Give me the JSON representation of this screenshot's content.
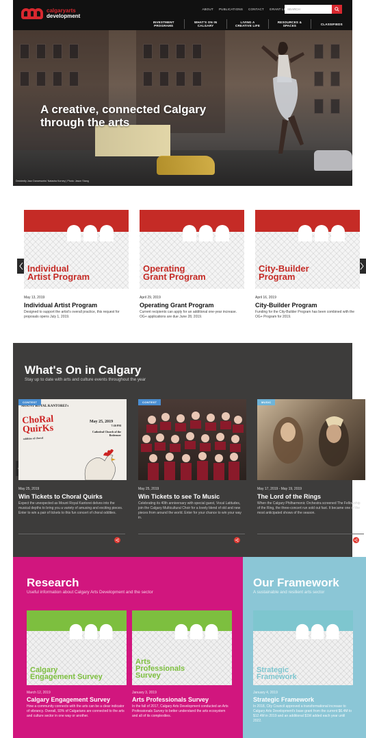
{
  "header": {
    "logo_line1": "calgaryarts",
    "logo_line2": "development",
    "utility_nav": [
      "ABOUT",
      "PUBLICATIONS",
      "CONTACT",
      "GRANT LOGIN"
    ],
    "search_placeholder": "SEARCH",
    "main_nav": [
      {
        "l1": "INVESTMENT",
        "l2": "PROGRAMS"
      },
      {
        "l1": "WHAT'S ON IN",
        "l2": "CALGARY"
      },
      {
        "l1": "LIVING A",
        "l2": "CREATIVE LIFE"
      },
      {
        "l1": "RESOURCES &",
        "l2": "SPACES"
      },
      {
        "l1": "CLASSIFIEDS",
        "l2": ""
      }
    ]
  },
  "hero": {
    "title_line1": "A creative, connected Calgary",
    "title_line2": "through the arts",
    "credit": "Decidedly Jazz Danceworks' Natasha Korney | Photo: Jason Stang"
  },
  "programs": [
    {
      "img_l1": "Individual",
      "img_l2": "Artist Program",
      "date": "May 13, 2019",
      "title": "Individual Artist Program",
      "desc": "Designed to support the artist's overall practice, this request for proposals opens July 1, 2019."
    },
    {
      "img_l1": "Operating",
      "img_l2": "Grant Program",
      "date": "April 29, 2019",
      "title": "Operating Grant Program",
      "desc": "Current recipients can apply for an additional one-year increase. OG+ applications are due June 28, 2019."
    },
    {
      "img_l1": "City-Builder",
      "img_l2": "Program",
      "date": "April 16, 2019",
      "title": "City-Builder Program",
      "desc": "Funding for the City-Builder Program has been combined with the OG+ Program for 2019."
    }
  ],
  "events_section": {
    "title": "What's On in Calgary",
    "subtitle": "Stay up to date with arts and culture events throughout the year"
  },
  "events": [
    {
      "tag": "CONTEST",
      "date": "May 25, 2019",
      "title": "Win Tickets to Choral Quirks",
      "desc": "Expect the unexpected as Mount Royal Kantorei delves into the musical depths to bring you a variety of amusing and exciting pieces. Enter to win a pair of tickets to this fun concert of choral oddities.",
      "poster_org": "MOUNT ROYAL KANTOREI's",
      "poster_title_1": "ChoRal",
      "poster_title_2": "QuirKs",
      "poster_sub": "oddities of choral",
      "poster_date": "May 25, 2019",
      "poster_time": "7:30 PM",
      "poster_venue": "Cathedral Church of the Redeemer"
    },
    {
      "tag": "CONTEST",
      "date": "May 25, 2019",
      "title": "Win Tickets to see To Music",
      "desc": "Celebrating its 40th anniversary with special guest, Vocal Latitudes, join the Calgary Multicultural Choir for a lovely blend of old and new pieces from around the world. Enter for your chance to win your way in."
    },
    {
      "tag": "MUSIC",
      "date": "May 17, 2019 - May 19, 2019",
      "title": "The Lord of the Rings",
      "desc": "When the Calgary Philharmonic Orchestra screened The Fellowship of the Ring, the three-concert run sold out fast. It became one of the most anticipated shows of the season."
    }
  ],
  "research": {
    "title": "Research",
    "subtitle": "Useful information about Calgary Arts Development and the sector",
    "cards": [
      {
        "img_l1": "Calgary",
        "img_l2": "Engagement Survey",
        "img_l3": "",
        "date": "March 12, 2019",
        "title": "Calgary Engagement Survey",
        "desc": "How a community connects with the arts can be a clear indicator of vibrancy. Overall, 93% of Calgarians are connected to the arts and culture sector in one way or another."
      },
      {
        "img_l1": "Arts",
        "img_l2": "Professionals",
        "img_l3": "Survey",
        "date": "January 3, 2019",
        "title": "Arts Professionals Survey",
        "desc": "In the fall of 2017, Calgary Arts Development conducted an Arts Professionals Survey to better understand the arts ecosystem and all of its complexities."
      }
    ]
  },
  "framework": {
    "title": "Our Framework",
    "subtitle": "A sustainable and resilient arts sector",
    "card": {
      "img_l1": "Strategic",
      "img_l2": "Framework",
      "date": "January 4, 2019",
      "title": "Strategic Framework",
      "desc": "In 2018, City Council approved a transformational increase to Calgary Arts Development's base grant from the current $6.4M to $12.4M in 2019 and an additional $1M added each year until 2022."
    }
  },
  "colors": {
    "brand_red": "#d7282f",
    "research_magenta": "#d1167e",
    "framework_blue": "#8bc6d6",
    "events_bg": "#3d3c3b",
    "research_green": "#7dbf3f",
    "framework_teal": "#7ec6cf"
  }
}
